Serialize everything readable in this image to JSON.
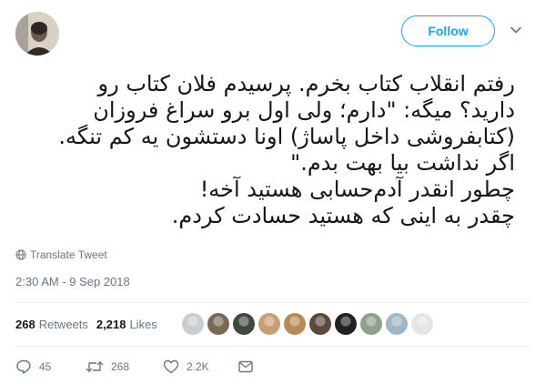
{
  "follow_button": {
    "label": "Follow"
  },
  "tweet": {
    "lines": [
      "رفتم انقلاب کتاب بخرم. پرسیدم فلان کتاب رو",
      "دارید؟ میگه: \"دارم؛ ولی اول برو سراغ فروزان",
      "(کتابفروشی داخل پاساژ) اونا دستشون یه کم تنگه.",
      "اگر نداشت بیا بهت بدم.\"",
      "چطور انقدر آدم‌حسابی هستید آخه!",
      "چقدر به اینی که هستید حسادت کردم."
    ]
  },
  "translate": {
    "label": "Translate Tweet",
    "icon": "globe-icon"
  },
  "timestamp": "2:30 AM - 9 Sep 2018",
  "stats": {
    "retweets_count": "268",
    "retweets_label": "Retweets",
    "likes_count": "2,218",
    "likes_label": "Likes"
  },
  "likers": [
    {
      "color": "#c7cdd3"
    },
    {
      "color": "#7a6a55"
    },
    {
      "color": "#3f4a3c"
    },
    {
      "color": "#c79f73"
    },
    {
      "color": "#b88a5a"
    },
    {
      "color": "#5b4a3a"
    },
    {
      "color": "#222222"
    },
    {
      "color": "#8ca08a"
    },
    {
      "color": "#9fb7c8"
    },
    {
      "color": "#e3e6e2"
    }
  ],
  "actions": {
    "reply_count": "45",
    "retweet_count": "268",
    "like_count": "2.2K"
  },
  "colors": {
    "accent": "#1da1f2",
    "secondary_text": "#657786",
    "divider": "#e6ecf0"
  }
}
